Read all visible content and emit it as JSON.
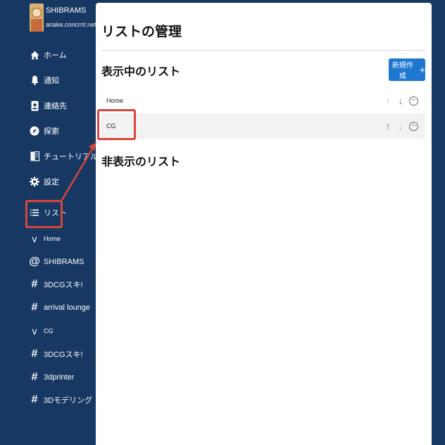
{
  "account": {
    "name": "SHIBRAMS",
    "host": "ariake.concrnt.net"
  },
  "nav": [
    {
      "label": "ホーム",
      "icon": "home-icon"
    },
    {
      "label": "通知",
      "icon": "bell-icon"
    },
    {
      "label": "連絡先",
      "icon": "contact-icon"
    },
    {
      "label": "探索",
      "icon": "compass-icon"
    },
    {
      "label": "チュートリアル",
      "icon": "book-icon"
    },
    {
      "label": "設定",
      "icon": "gear-icon"
    }
  ],
  "lists_nav": {
    "label": "リスト",
    "icon": "list-icon"
  },
  "list_groups": [
    {
      "label": "Home",
      "items": [
        {
          "label": "SHIBRAMS",
          "icon": "at-icon"
        },
        {
          "label": "3DCGスキ!",
          "icon": "hash-icon"
        },
        {
          "label": "arrival lounge",
          "icon": "hash-icon"
        }
      ]
    },
    {
      "label": "CG",
      "items": [
        {
          "label": "3DCGスキ!",
          "icon": "hash-icon"
        },
        {
          "label": "3dprinter",
          "icon": "hash-icon"
        },
        {
          "label": "3Dモデリング",
          "icon": "hash-icon"
        }
      ]
    }
  ],
  "main": {
    "title": "リストの管理",
    "visible_section": "表示中のリスト",
    "hidden_section": "非表示のリスト",
    "new_button": "新規作成",
    "new_button_icon": "+",
    "lists": [
      {
        "name": "Home",
        "up_enabled": false,
        "down_enabled": true
      },
      {
        "name": "CG",
        "up_enabled": true,
        "down_enabled": false
      }
    ]
  },
  "colors": {
    "sidebar": "#163863",
    "accent": "#1e78d2",
    "highlight": "#d9453a"
  }
}
